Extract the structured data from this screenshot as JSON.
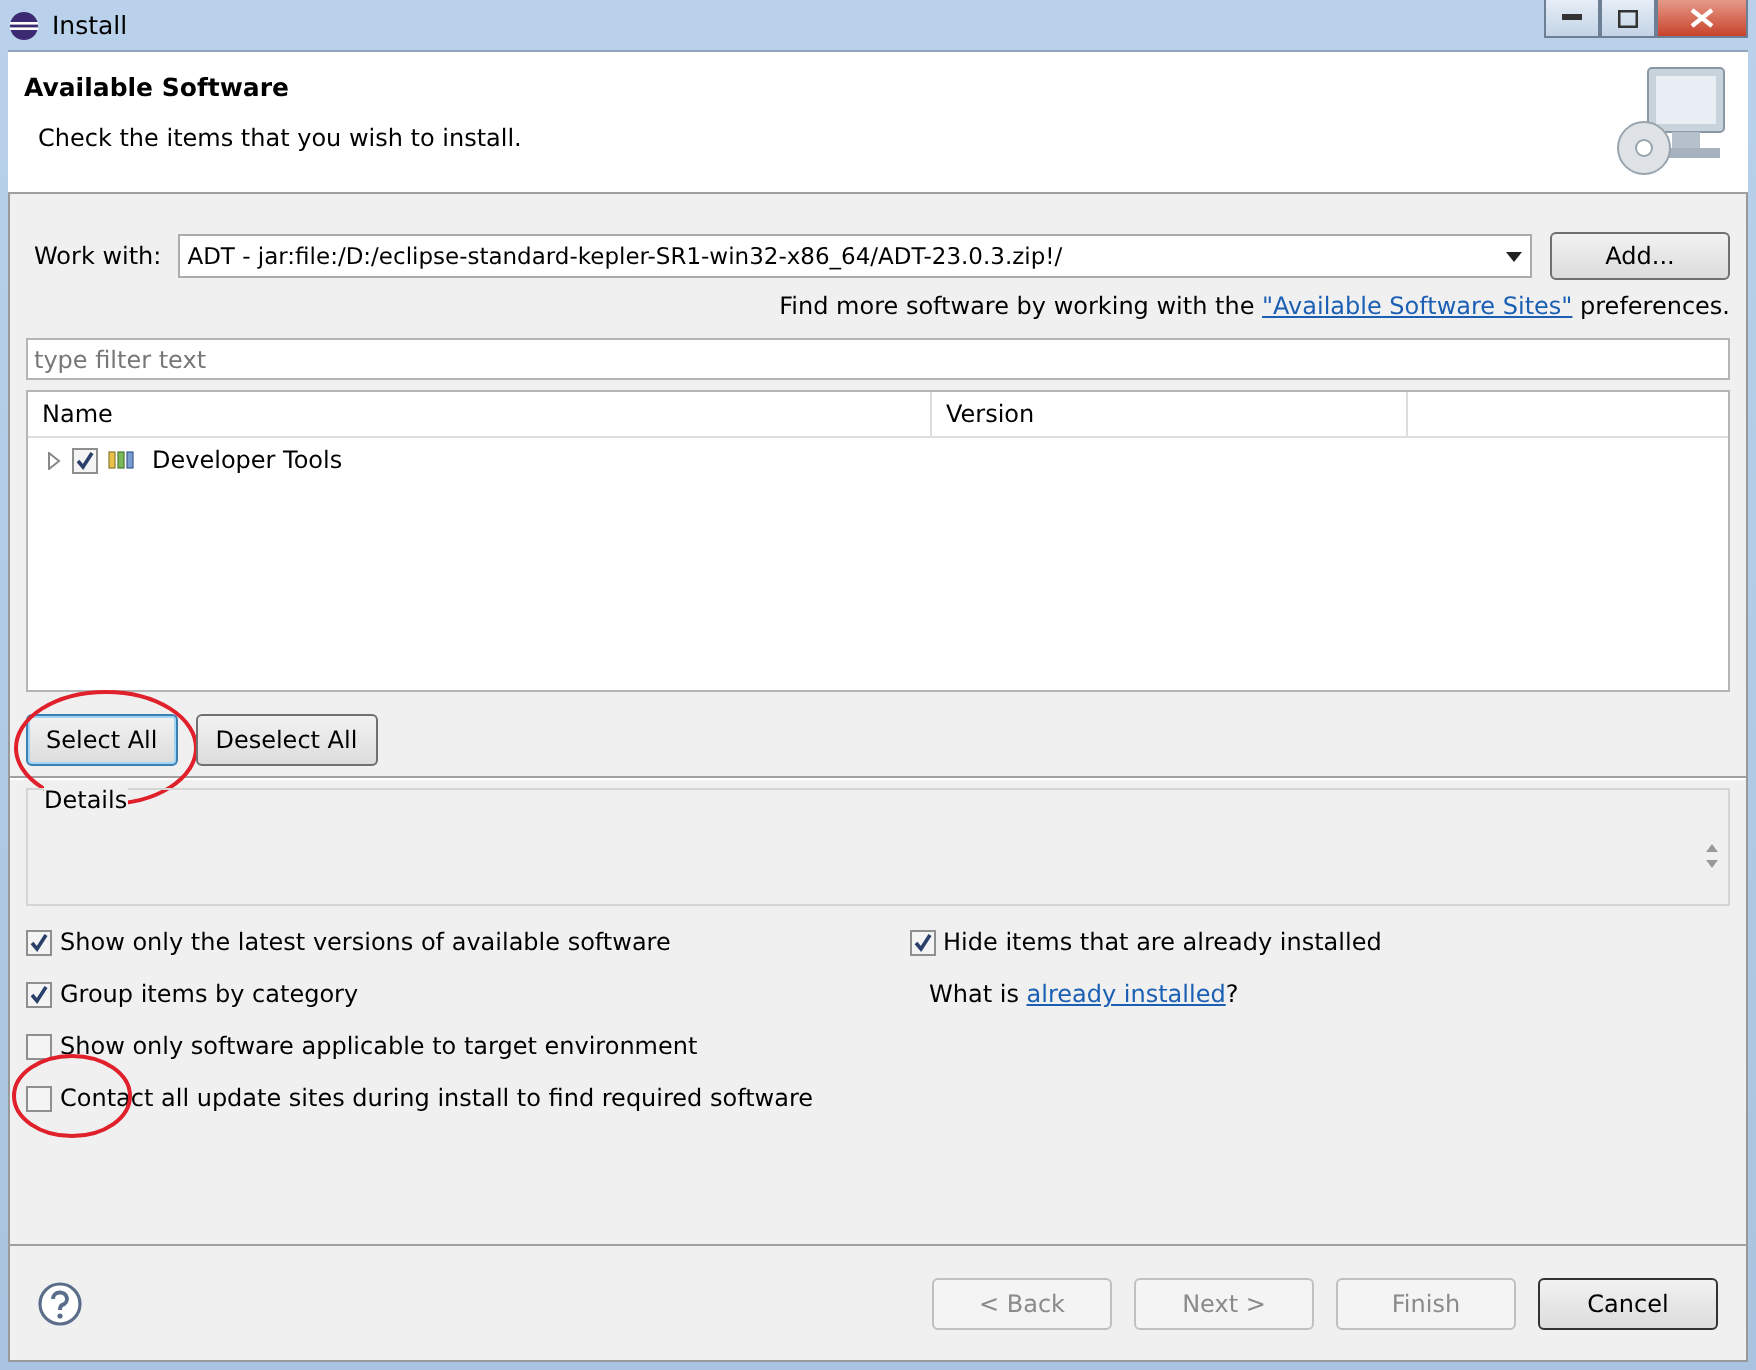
{
  "window": {
    "title": "Install"
  },
  "header": {
    "title": "Available Software",
    "subtitle": "Check the items that you wish to install."
  },
  "work_with": {
    "label": "Work with:",
    "value": "ADT - jar:file:/D:/eclipse-standard-kepler-SR1-win32-x86_64/ADT-23.0.3.zip!/",
    "add_button": "Add..."
  },
  "sites_note": {
    "before": "Find more software by working with the",
    "link": "\"Available Software Sites\"",
    "after": "preferences."
  },
  "filter": {
    "placeholder": "type filter text"
  },
  "tree": {
    "columns": [
      "Name",
      "Version"
    ],
    "items": [
      {
        "label": "Developer Tools",
        "checked": true,
        "expanded": false
      }
    ]
  },
  "selection_buttons": [
    {
      "label": "Select All",
      "circled": true
    },
    {
      "label": "Deselect All",
      "circled": false
    }
  ],
  "details": {
    "label": "Details"
  },
  "options_left": [
    {
      "label": "Show only the latest versions of available software",
      "checked": true,
      "circled": false
    },
    {
      "label": "Group items by category",
      "checked": true,
      "circled": false
    },
    {
      "label": "Show only software applicable to target environment",
      "checked": false,
      "circled": false
    },
    {
      "label": "Contact all update sites during install to find required software",
      "checked": false,
      "circled": true
    }
  ],
  "options_right": {
    "hide_installed": {
      "label": "Hide items that are already installed",
      "checked": true
    },
    "what_is": {
      "before": "What is",
      "link": "already installed",
      "after": "?"
    }
  },
  "footer": {
    "buttons": [
      {
        "label": "< Back",
        "disabled": true,
        "default": false
      },
      {
        "label": "Next >",
        "disabled": true,
        "default": false
      },
      {
        "label": "Finish",
        "disabled": true,
        "default": false
      },
      {
        "label": "Cancel",
        "disabled": false,
        "default": true
      }
    ]
  }
}
